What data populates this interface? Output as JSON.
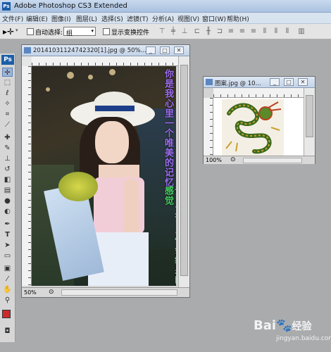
{
  "app": {
    "title": "Adobe Photoshop CS3 Extended",
    "logo": "Ps"
  },
  "menu": [
    "文件(F)",
    "编辑(E)",
    "图像(I)",
    "图层(L)",
    "选择(S)",
    "滤镜(T)",
    "分析(A)",
    "视图(V)",
    "窗口(W)",
    "帮助(H)"
  ],
  "options": {
    "auto_select_label": "自动选择:",
    "auto_select_value": "组",
    "show_transform_label": "显示变换控件"
  },
  "doc1": {
    "title": "20141031124742320[1].jpg @ 50%...",
    "zoom": "50%",
    "overlay_text_col1": "你是我心里一个唯美的记忆",
    "overlay_text_col2": "说，又可以体会纹身的感觉"
  },
  "doc2": {
    "title": "图案.jpg @ 10...",
    "zoom": "100%"
  },
  "watermark": {
    "brand": "Bai",
    "brand_suffix": "经验",
    "url": "jingyan.baidu.com"
  },
  "colors": {
    "foreground": "#cc2b2b",
    "background": "#ffffff",
    "accent": "#1c5ea8"
  }
}
